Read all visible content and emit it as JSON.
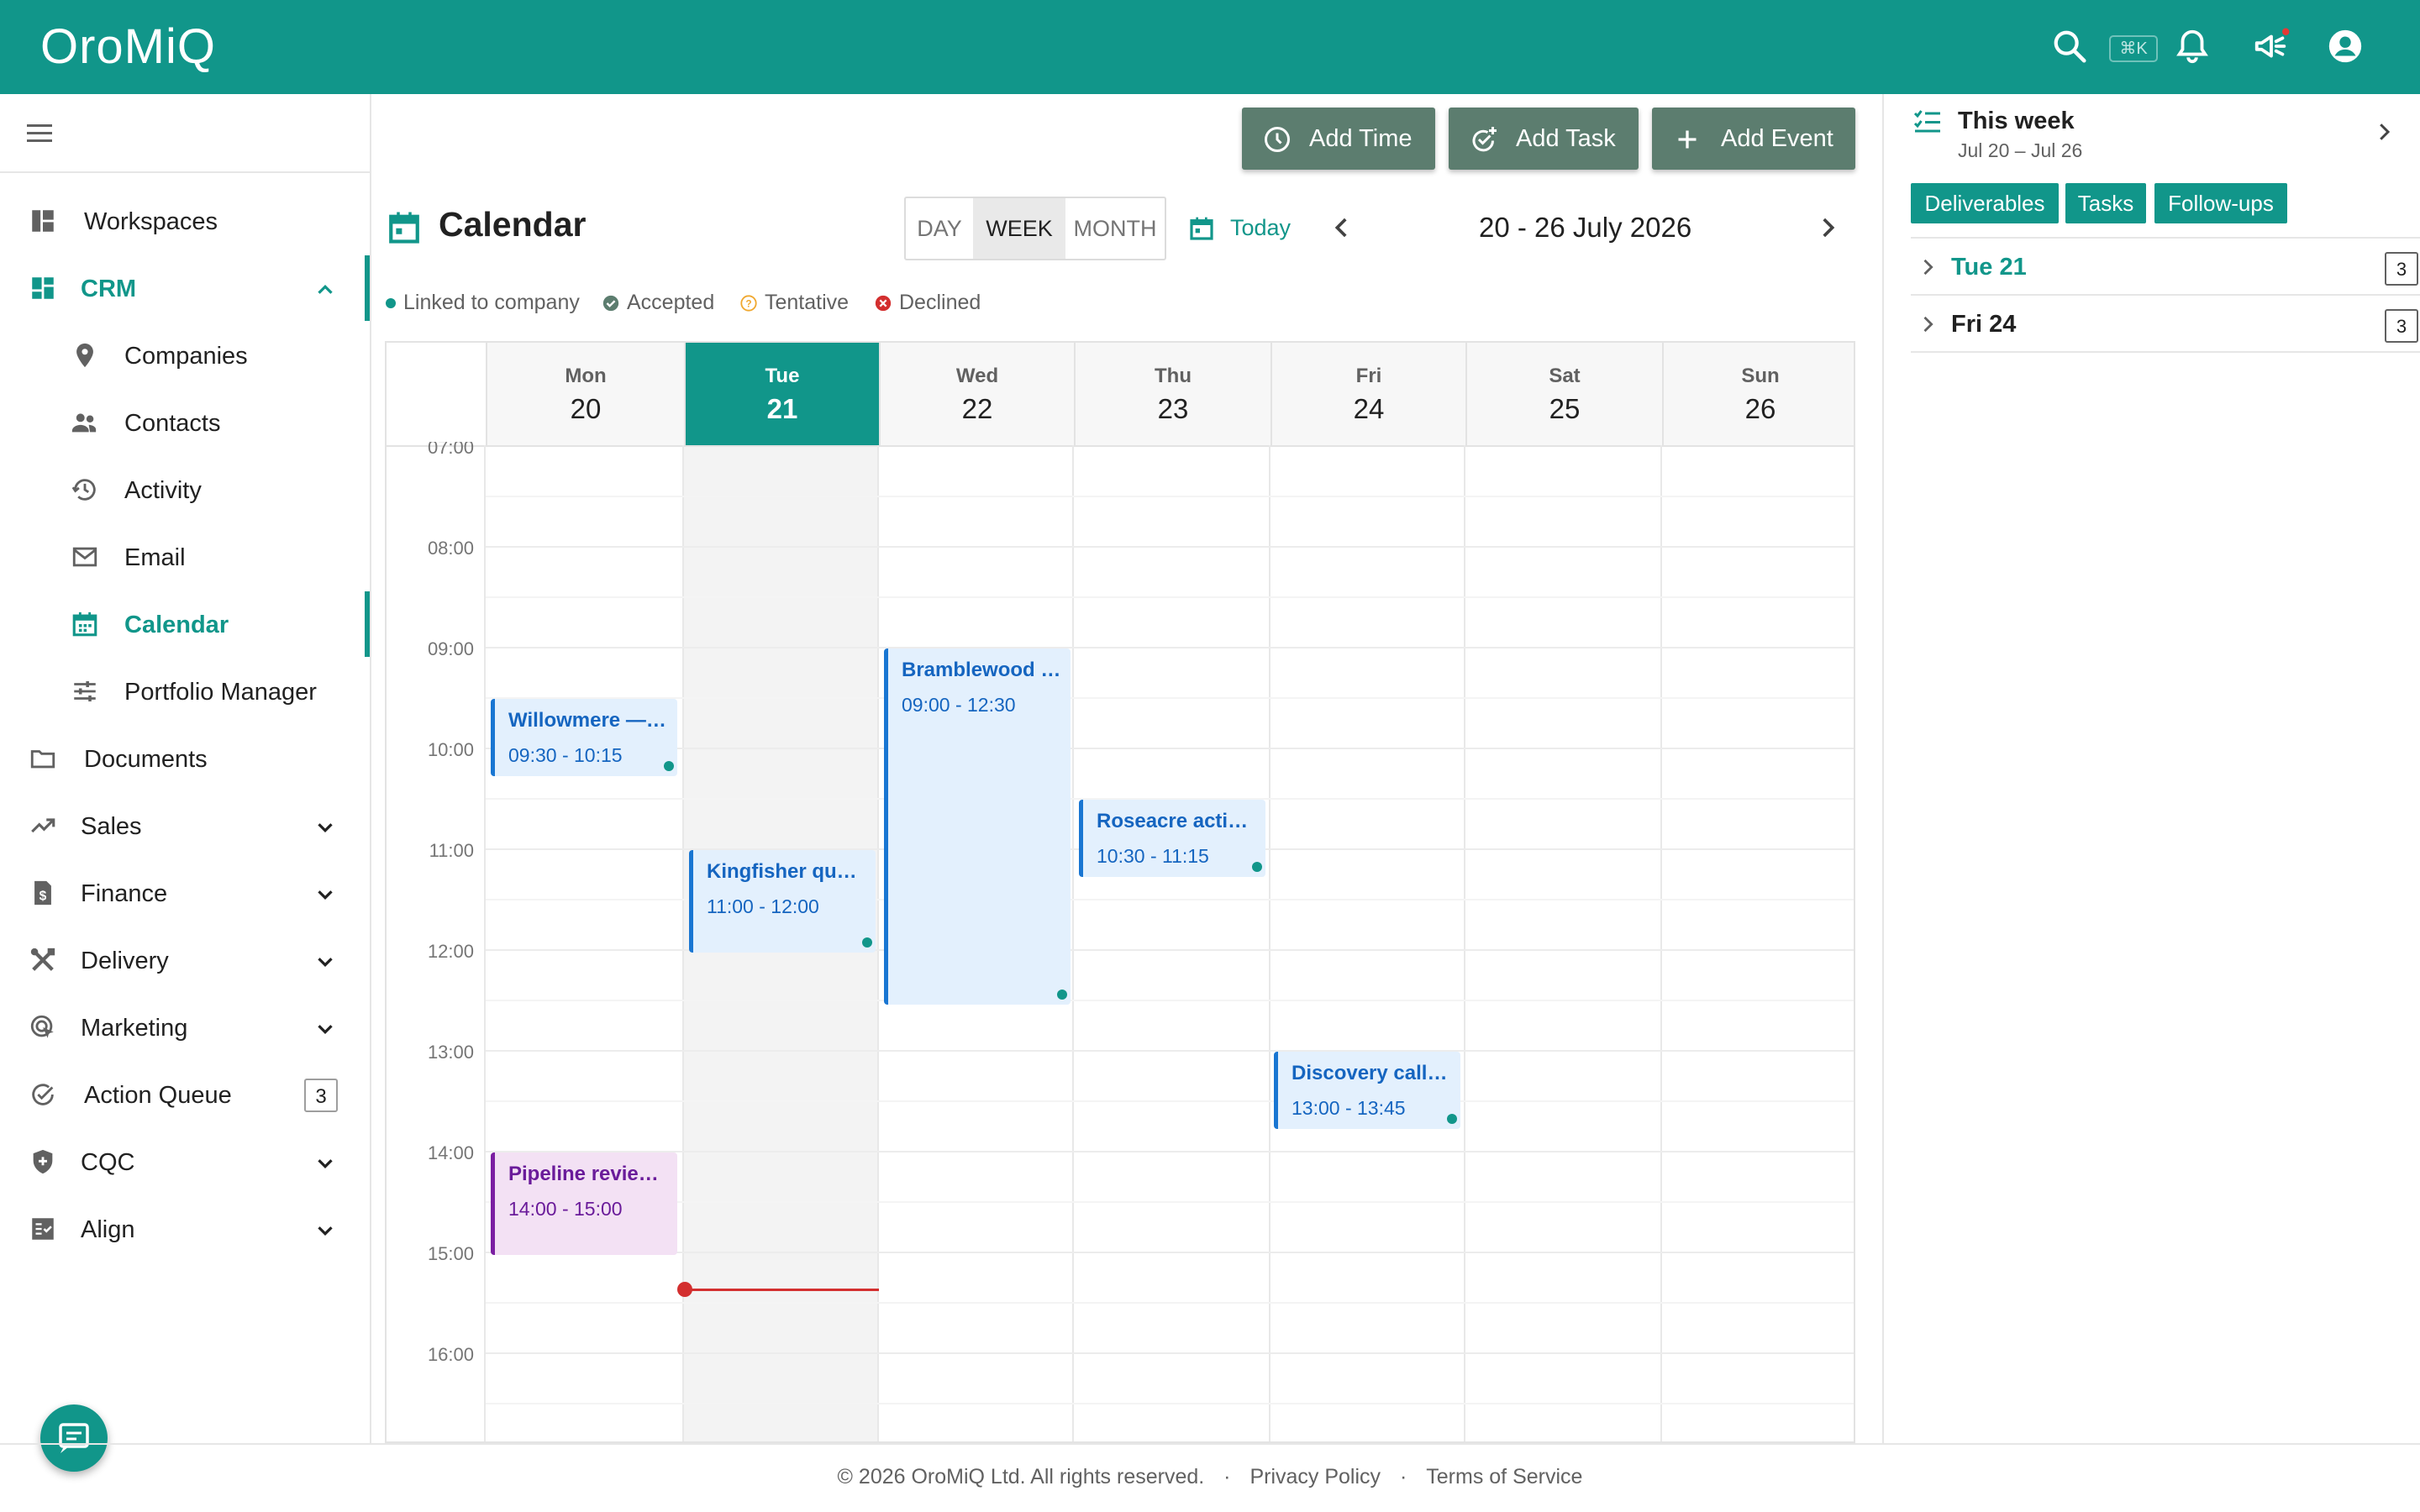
{
  "header": {
    "logo": "OroMiQ",
    "shortcut": "⌘K"
  },
  "sidebar": {
    "items": [
      {
        "label": "Workspaces"
      },
      {
        "label": "CRM"
      },
      {
        "label": "Companies"
      },
      {
        "label": "Contacts"
      },
      {
        "label": "Activity"
      },
      {
        "label": "Email"
      },
      {
        "label": "Calendar"
      },
      {
        "label": "Portfolio Manager"
      },
      {
        "label": "Documents"
      },
      {
        "label": "Sales"
      },
      {
        "label": "Finance"
      },
      {
        "label": "Delivery"
      },
      {
        "label": "Marketing"
      },
      {
        "label": "Action Queue",
        "badge": "3"
      },
      {
        "label": "CQC"
      },
      {
        "label": "Align"
      }
    ]
  },
  "toolbar": {
    "add_time": "Add Time",
    "add_task": "Add Task",
    "add_event": "Add Event"
  },
  "calendar": {
    "title": "Calendar",
    "views": [
      "DAY",
      "WEEK",
      "MONTH"
    ],
    "selected_view": "WEEK",
    "today_label": "Today",
    "range": "20 - 26 July 2026",
    "legend": [
      "Linked to company",
      "Accepted",
      "Tentative",
      "Declined"
    ],
    "days": [
      {
        "name": "Mon",
        "date": "20"
      },
      {
        "name": "Tue",
        "date": "21"
      },
      {
        "name": "Wed",
        "date": "22"
      },
      {
        "name": "Thu",
        "date": "23"
      },
      {
        "name": "Fri",
        "date": "24"
      },
      {
        "name": "Sat",
        "date": "25"
      },
      {
        "name": "Sun",
        "date": "26"
      }
    ],
    "times": [
      "07:00",
      "08:00",
      "09:00",
      "10:00",
      "11:00",
      "12:00",
      "13:00",
      "14:00",
      "15:00",
      "16:00"
    ],
    "events": [
      {
        "title": "Willowmere —…",
        "time": "09:30 - 10:15"
      },
      {
        "title": "Kingfisher qua…",
        "time": "11:00 - 12:00"
      },
      {
        "title": "Bramblewood …",
        "time": "09:00 - 12:30"
      },
      {
        "title": "Roseacre acti…",
        "time": "10:30 - 11:15"
      },
      {
        "title": "Discovery call …",
        "time": "13:00 - 13:45"
      },
      {
        "title": "Pipeline revie…",
        "time": "14:00 - 15:00"
      }
    ]
  },
  "right_panel": {
    "title": "This week",
    "subtitle": "Jul 20 – Jul 26",
    "chips": [
      "Deliverables",
      "Tasks",
      "Follow-ups"
    ],
    "rows": [
      {
        "label": "Tue 21",
        "count": "3"
      },
      {
        "label": "Fri 24",
        "count": "3"
      }
    ]
  },
  "footer": {
    "copyright": "© 2026 OroMiQ Ltd. All rights reserved.",
    "sep": "·",
    "privacy": "Privacy Policy",
    "terms": "Terms of Service"
  },
  "colors": {
    "brand": "#11968a",
    "button": "#5c7d6f",
    "event_blue": "#1565c0",
    "event_purple": "#6a1b9a",
    "now_line": "#d32f2f"
  }
}
